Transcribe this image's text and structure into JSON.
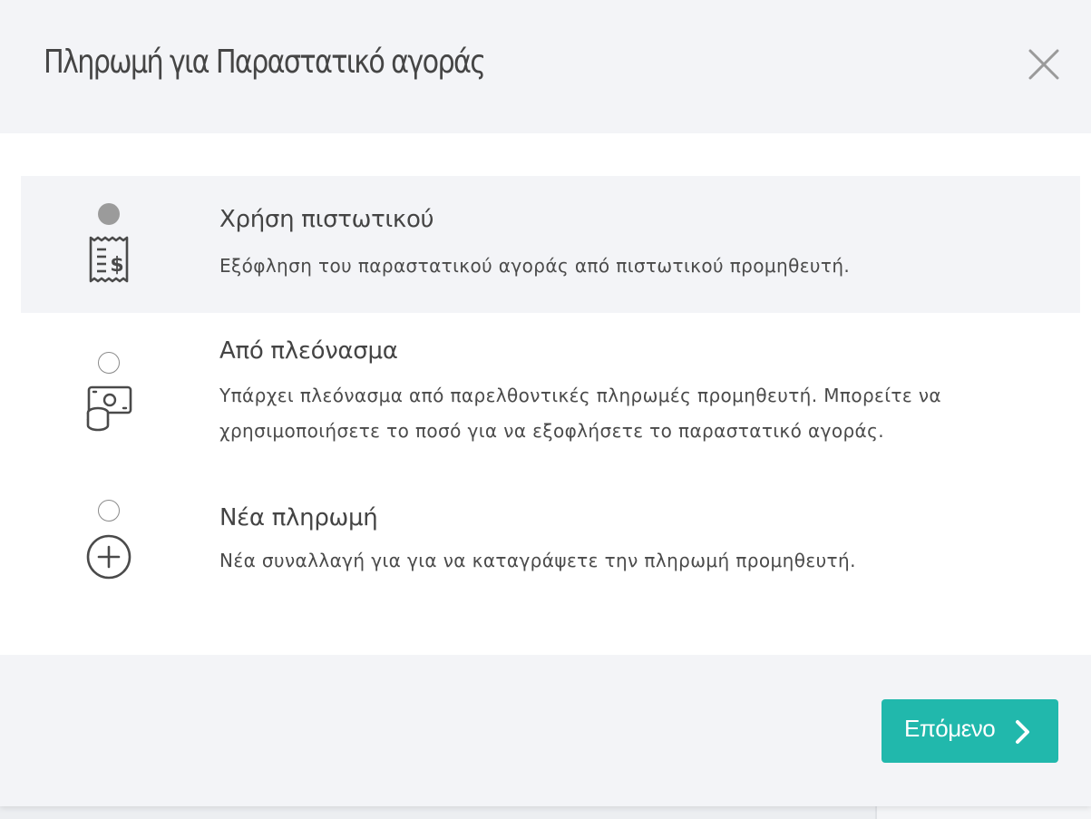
{
  "dialog": {
    "title": "Πληρωμή για Παραστατικό αγοράς"
  },
  "options": [
    {
      "title": "Χρήση πιστωτικού",
      "description": "Εξόφληση του παραστατικού αγοράς από πιστωτικού προμηθευτή.",
      "icon": "receipt-dollar-icon",
      "selected": true
    },
    {
      "title": "Από πλεόνασμα",
      "description": "Υπάρχει πλεόνασμα από παρελθοντικές πληρωμές προμηθευτή. Μπορείτε να χρησιμοποιήσετε το ποσό για να εξοφλήσετε το παραστατικό αγοράς.",
      "icon": "cash-coins-icon",
      "selected": false
    },
    {
      "title": "Νέα πληρωμή",
      "description": "Νέα συναλλαγή για για να καταγράψετε την πληρωμή προμηθευτή.",
      "icon": "plus-circle-icon",
      "selected": false
    }
  ],
  "footer": {
    "next_label": "Επόμενο"
  },
  "colors": {
    "accent": "#21b8ac",
    "header_bg": "#f3f4f7",
    "selected_bg": "#f3f4f7",
    "text": "#454545",
    "radio_checked": "#9b9b9b"
  }
}
